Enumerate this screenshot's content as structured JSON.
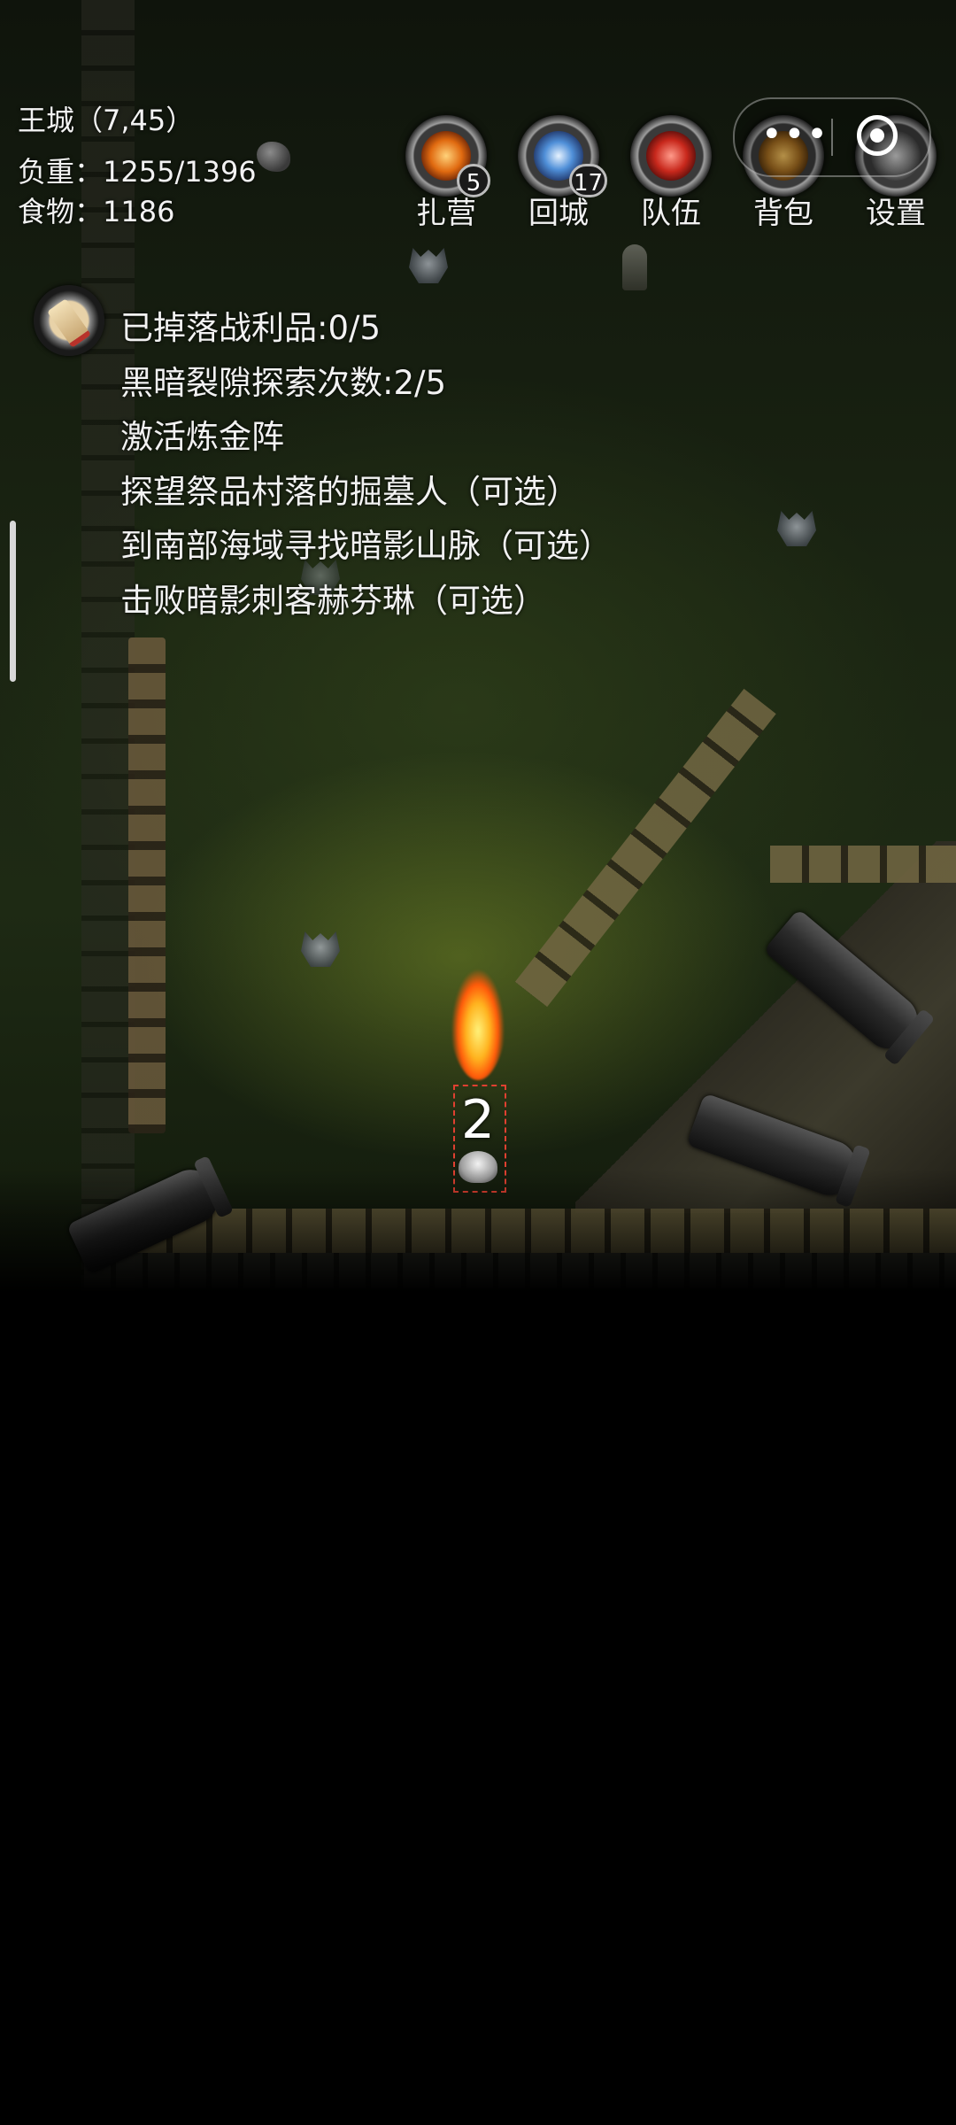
{
  "hud": {
    "location": "王城（7,45）",
    "weight": "负重：1255/1396",
    "food": "食物：1186"
  },
  "toolbar": {
    "camp": {
      "label": "扎营",
      "icon": "campfire-icon",
      "count": "5"
    },
    "recall": {
      "label": "回城",
      "icon": "portal-icon",
      "count": "17"
    },
    "team": {
      "label": "队伍",
      "icon": "team-icon"
    },
    "bag": {
      "label": "背包",
      "icon": "backpack-icon"
    },
    "settings": {
      "label": "设置",
      "icon": "gear-icon"
    }
  },
  "capsule": {
    "more_label": "•••",
    "more_icon": "more-icon",
    "close_icon": "close-target-icon"
  },
  "quest": {
    "icon": "quest-scroll-icon",
    "items": [
      "已掉落战利品:0/5",
      "黑暗裂隙探索次数:2/5",
      "激活炼金阵",
      "探望祭品村落的掘墓人（可选）",
      "到南部海域寻找暗影山脉（可选）",
      "击败暗影刺客赫芬琳（可选）"
    ]
  },
  "player": {
    "party_number": "2"
  },
  "colors": {
    "text": "#f2f2f2",
    "background": "#000000",
    "selection": "#e04030",
    "fire": "#ff8a1a"
  }
}
